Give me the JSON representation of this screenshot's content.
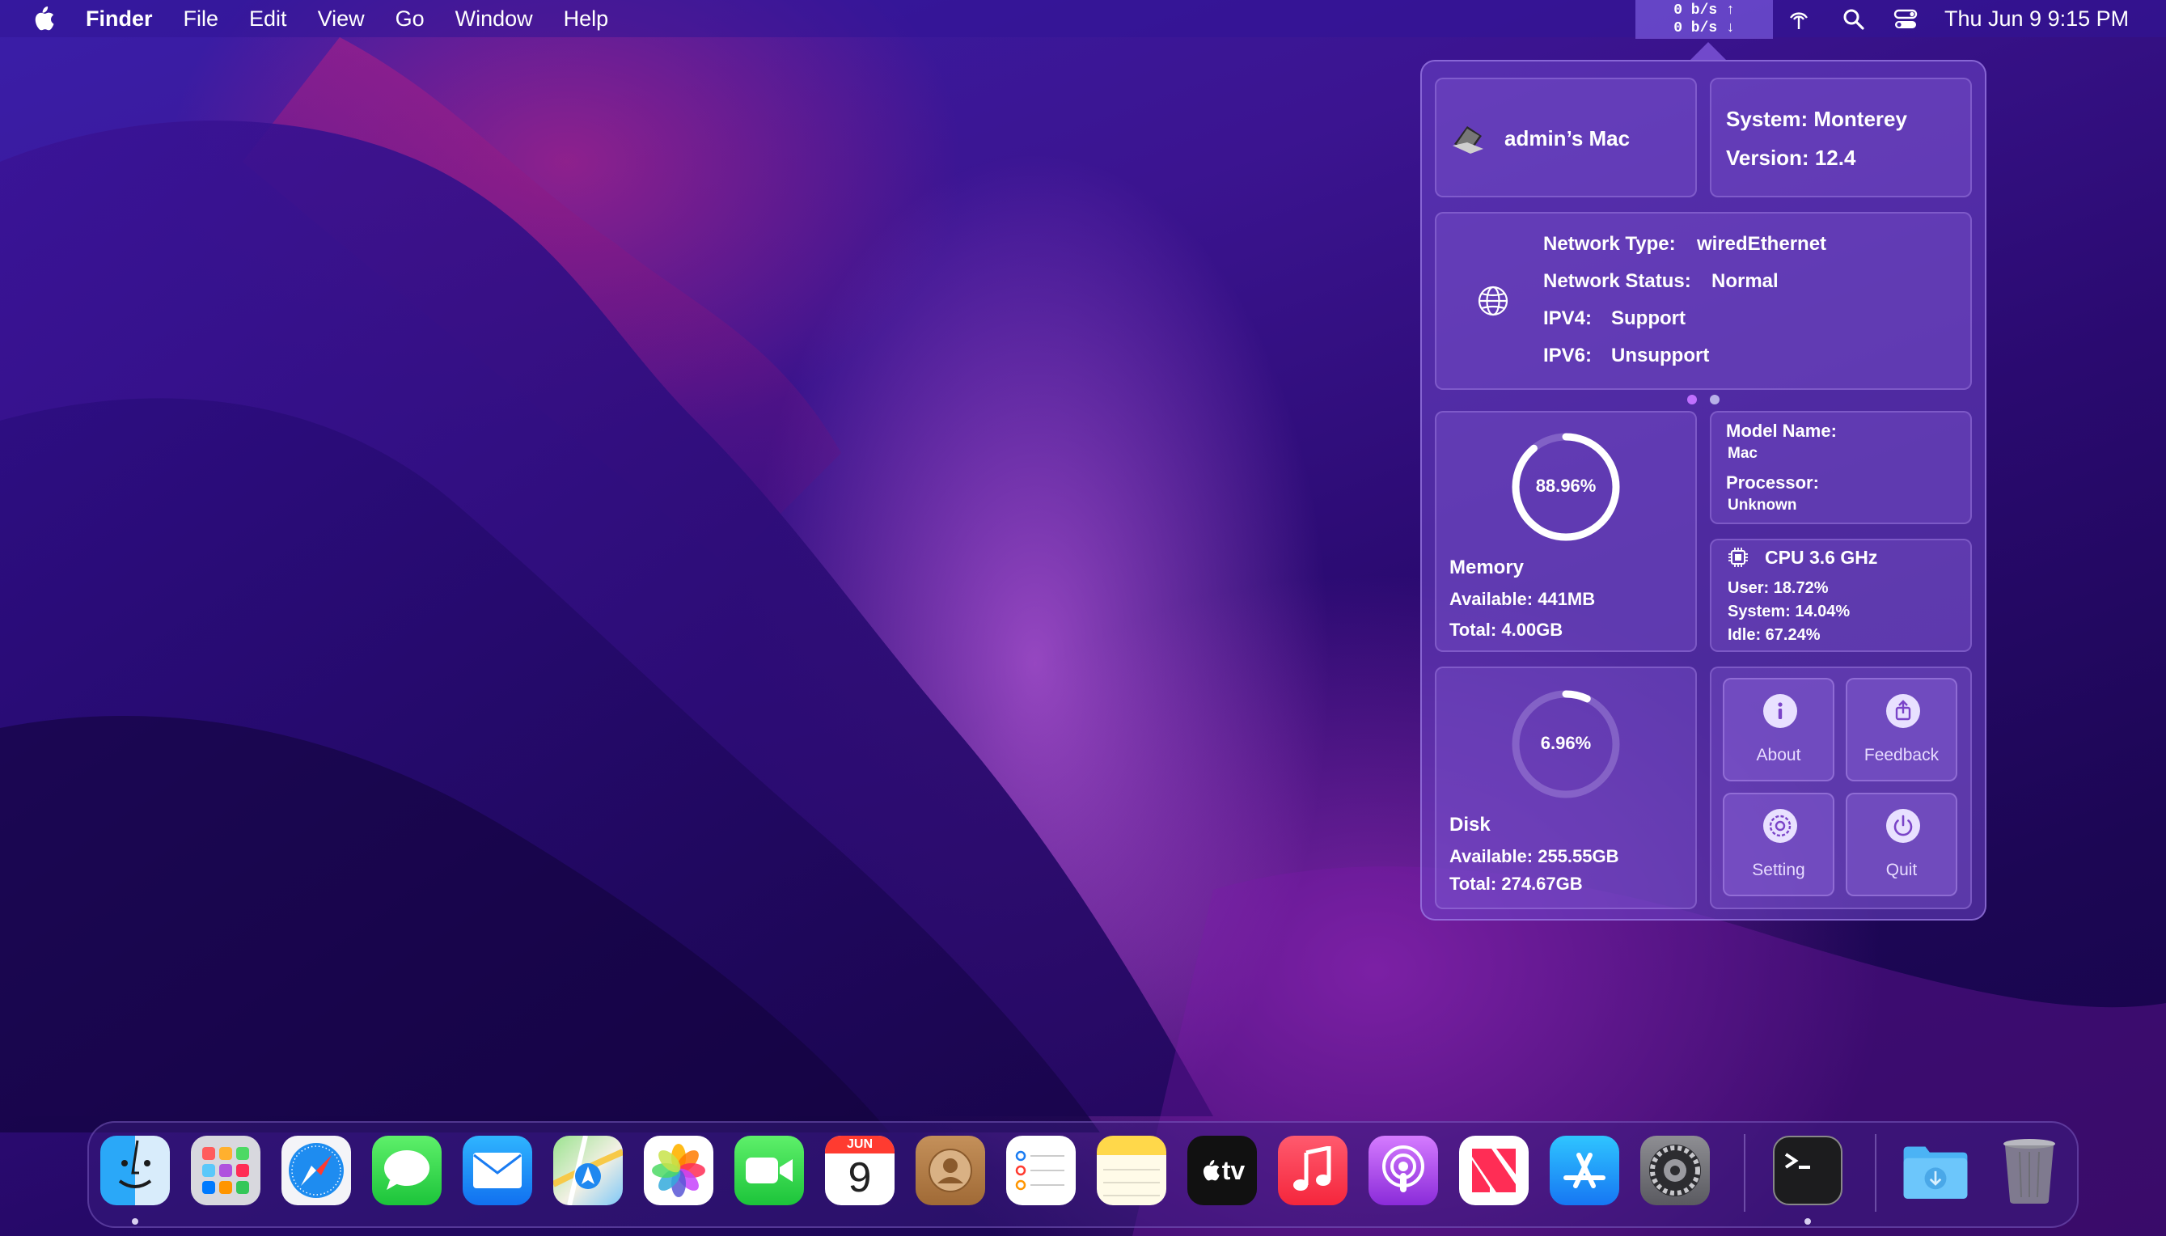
{
  "menubar": {
    "app_name": "Finder",
    "menus": [
      "File",
      "Edit",
      "View",
      "Go",
      "Window",
      "Help"
    ],
    "net_up": "0  b/s ↑",
    "net_down": "0  b/s ↓",
    "clock": "Thu Jun 9  9:15 PM"
  },
  "popover": {
    "device_name": "admin’s Mac",
    "system": "System: Monterey",
    "version": "Version: 12.4",
    "network": {
      "type_label": "Network Type:",
      "type_value": "wiredEthernet",
      "status_label": "Network Status:",
      "status_value": "Normal",
      "ipv4_label": "IPV4:",
      "ipv4_value": "Support",
      "ipv6_label": "IPV6:",
      "ipv6_value": "Unsupport"
    },
    "memory": {
      "percent_text": "88.96%",
      "percent": 88.96,
      "title": "Memory",
      "available": "Available: 441MB",
      "total": "Total: 4.00GB"
    },
    "model": {
      "model_label": "Model Name:",
      "model_value": "Mac",
      "processor_label": "Processor:",
      "processor_value": "Unknown"
    },
    "cpu": {
      "title": "CPU  3.6 GHz",
      "user": "User:   18.72%",
      "system": "System:   14.04%",
      "idle": "Idle:   67.24%"
    },
    "disk": {
      "percent_text": "6.96%",
      "percent": 6.96,
      "title": "Disk",
      "available": "Available: 255.55GB",
      "total": "Total: 274.67GB"
    },
    "buttons": {
      "about": "About",
      "feedback": "Feedback",
      "setting": "Setting",
      "quit": "Quit"
    }
  },
  "dock": {
    "calendar_month": "JUN",
    "calendar_day": "9",
    "tv_label": "tv"
  }
}
